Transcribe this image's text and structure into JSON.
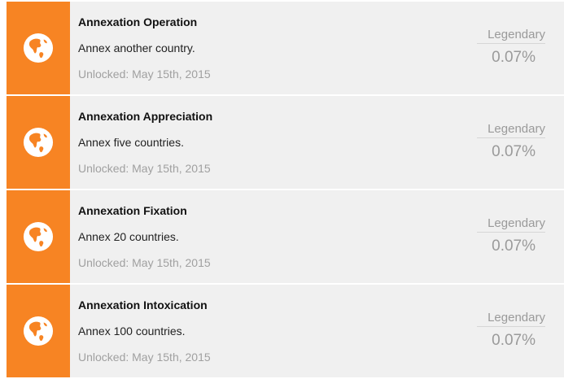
{
  "achievements": [
    {
      "icon": "globe-icon",
      "title": "Annexation Operation",
      "description": "Annex another country.",
      "unlocked": "Unlocked: May 15th, 2015",
      "rarity": "Legendary",
      "percent": "0.07%"
    },
    {
      "icon": "globe-icon",
      "title": "Annexation Appreciation",
      "description": "Annex five countries.",
      "unlocked": "Unlocked: May 15th, 2015",
      "rarity": "Legendary",
      "percent": "0.07%"
    },
    {
      "icon": "globe-icon",
      "title": "Annexation Fixation",
      "description": "Annex 20 countries.",
      "unlocked": "Unlocked: May 15th, 2015",
      "rarity": "Legendary",
      "percent": "0.07%"
    },
    {
      "icon": "globe-icon",
      "title": "Annexation Intoxication",
      "description": "Annex 100 countries.",
      "unlocked": "Unlocked: May 15th, 2015",
      "rarity": "Legendary",
      "percent": "0.07%"
    }
  ],
  "colors": {
    "icon_tile": "#f78423",
    "row_background": "#f0f0f0",
    "muted_text": "#9a9a9a"
  }
}
